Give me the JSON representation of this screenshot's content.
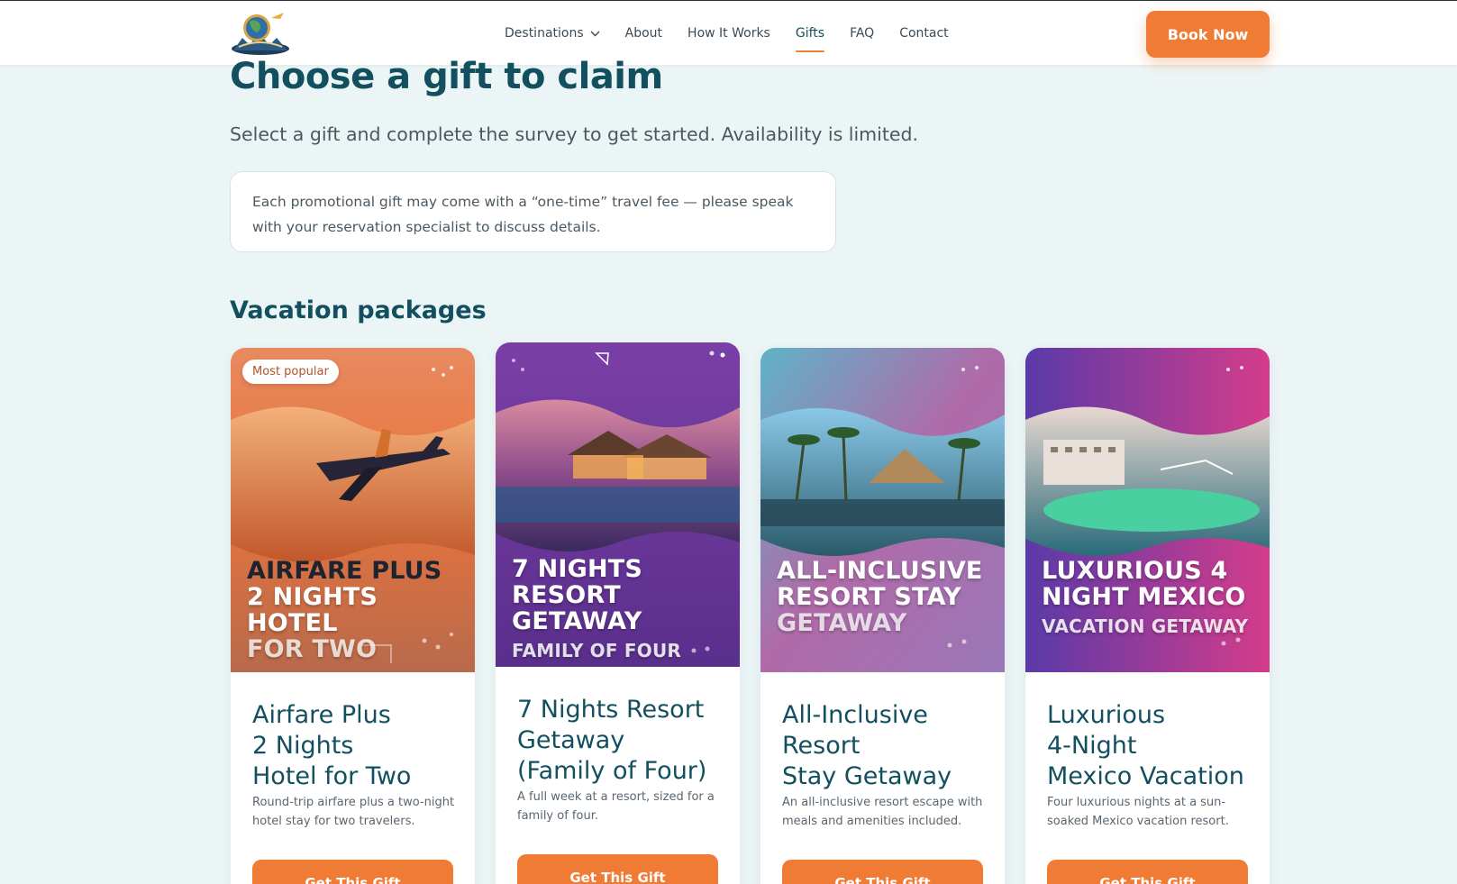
{
  "header": {
    "logo_icon": "globe-plane-logo",
    "nav": [
      {
        "label": "Destinations",
        "has_dropdown": true,
        "active": false
      },
      {
        "label": "About",
        "active": false
      },
      {
        "label": "How It Works",
        "active": false
      },
      {
        "label": "Gifts",
        "active": true
      },
      {
        "label": "FAQ",
        "active": false
      },
      {
        "label": "Contact",
        "active": false
      }
    ],
    "cta_label": "Book Now"
  },
  "main": {
    "title": "Choose a gift to claim",
    "subtitle": "Select a gift and complete the survey to get started. Availability is limited.",
    "notice": "Each promotional gift may come with a “one-time” travel fee — please speak with your reservation specialist to discuss details.",
    "section_title": "Vacation packages"
  },
  "cards": [
    {
      "badge": "Most popular",
      "poster_line1": "Airfare Plus",
      "poster_line2": "2 Nights Hotel",
      "poster_line3": "for Two",
      "title": "Airfare Plus\n2 Nights\nHotel for Two",
      "description": "Round-trip airfare plus a two-night hotel stay for two travelers.",
      "button": "Get This Gift"
    },
    {
      "poster_line1": "7 Nights Resort",
      "poster_line2": "Getaway",
      "poster_line3": "Family of Four",
      "title": "7 Nights Resort\nGetaway\n(Family of Four)",
      "description": "A full week at a resort, sized for a family of four.",
      "button": "Get This Gift"
    },
    {
      "poster_line1": "All-Inclusive",
      "poster_line2": "Resort Stay",
      "poster_line3": "Getaway",
      "title": "All-Inclusive\nResort\nStay Getaway",
      "description": "An all-inclusive resort escape with meals and amenities included.",
      "button": "Get This Gift"
    },
    {
      "poster_line1": "Luxurious 4",
      "poster_line2": "Night Mexico",
      "poster_line3": "Vacation Getaway",
      "title": "Luxurious\n4-Night\nMexico Vacation",
      "description": "Four luxurious nights at a sun-soaked Mexico vacation resort.",
      "button": "Get This Gift"
    }
  ],
  "colors": {
    "brand": "#12505f",
    "accent": "#ef7b35",
    "background": "#ecf5f6"
  }
}
